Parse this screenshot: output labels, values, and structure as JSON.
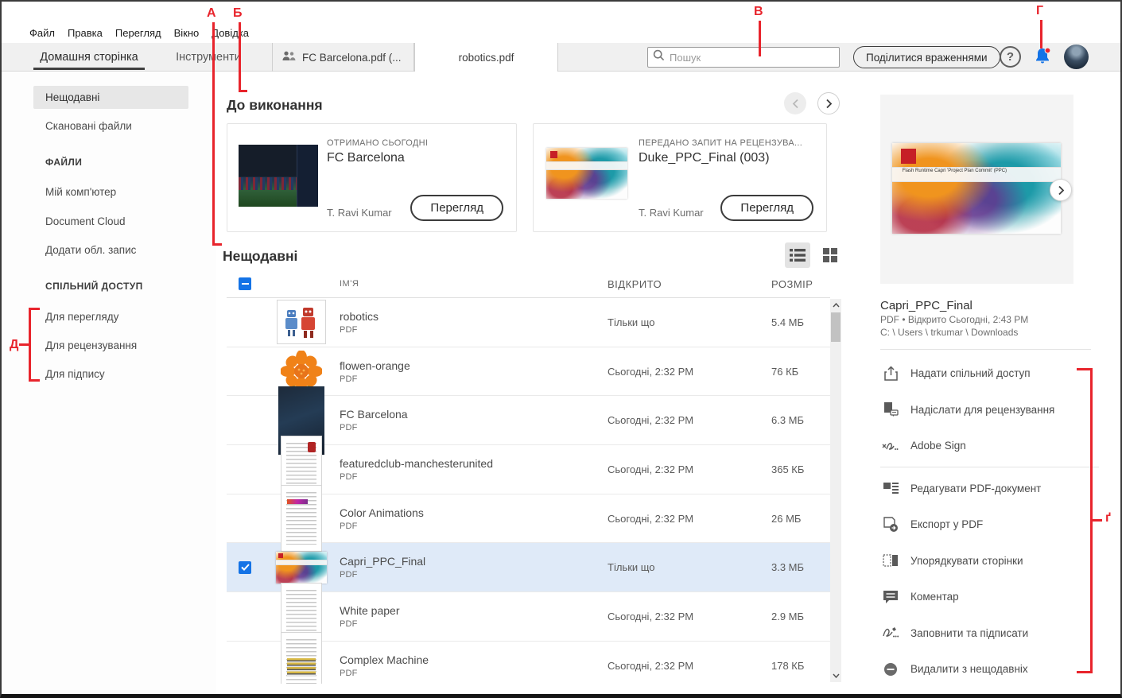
{
  "menubar": {
    "items": [
      "Файл",
      "Правка",
      "Перегляд",
      "Вікно",
      "Довідка"
    ]
  },
  "tabbar": {
    "home": "Домашня сторінка",
    "tools": "Інструменти",
    "doc_tab1": "FC Barcelona.pdf (...",
    "doc_tab2": "robotics.pdf",
    "search_placeholder": "Пошук",
    "share_feedback": "Поділитися враженнями",
    "help_glyph": "?"
  },
  "sidebar": {
    "recent": "Нещодавні",
    "scans": "Скановані файли",
    "files_header": "ФАЙЛИ",
    "my_computer": "Мій комп'ютер",
    "document_cloud": "Document Cloud",
    "add_account": "Додати обл. запис",
    "shared_header": "СПІЛЬНИЙ ДОСТУП",
    "for_viewing": "Для перегляду",
    "for_review": "Для рецензування",
    "for_signature": "Для підпису"
  },
  "todo": {
    "title": "До виконання",
    "cards": [
      {
        "badge": "ОТРИМАНО СЬОГОДНІ",
        "title": "FC Barcelona",
        "owner": "T. Ravi Kumar",
        "action": "Перегляд"
      },
      {
        "badge": "ПЕРЕДАНО ЗАПИТ НА РЕЦЕНЗУВА...",
        "title": "Duke_PPC_Final (003)",
        "owner": "T. Ravi Kumar",
        "action": "Перегляд"
      }
    ]
  },
  "recent": {
    "title": "Нещодавні",
    "columns": {
      "name": "ІМ'Я",
      "opened": "ВІДКРИТО",
      "size": "РОЗМІР"
    },
    "rows": [
      {
        "name": "robotics",
        "type": "PDF",
        "opened": "Тільки що",
        "size": "5.4 МБ"
      },
      {
        "name": "flowen-orange",
        "type": "PDF",
        "opened": "Сьогодні, 2:32 PM",
        "size": "76 КБ"
      },
      {
        "name": "FC Barcelona",
        "type": "PDF",
        "opened": "Сьогодні, 2:32 PM",
        "size": "6.3 МБ"
      },
      {
        "name": "featuredclub-manchesterunited",
        "type": "PDF",
        "opened": "Сьогодні, 2:32 PM",
        "size": "365 КБ"
      },
      {
        "name": "Color Animations",
        "type": "PDF",
        "opened": "Сьогодні, 2:32 PM",
        "size": "26 МБ"
      },
      {
        "name": "Capri_PPC_Final",
        "type": "PDF",
        "opened": "Тільки що",
        "size": "3.3 МБ"
      },
      {
        "name": "White paper",
        "type": "PDF",
        "opened": "Сьогодні, 2:32 PM",
        "size": "2.9 МБ"
      },
      {
        "name": "Complex Machine",
        "type": "PDF",
        "opened": "Сьогодні, 2:32 PM",
        "size": "178 КБ"
      }
    ]
  },
  "details": {
    "preview_title": "Flash Runtime Capri 'Project Plan Commit' (PPC)",
    "title": "Capri_PPC_Final",
    "meta": "PDF  •  Відкрито Сьогодні, 2:43 PM",
    "path": "C: \\ Users \\ trkumar \\ Downloads",
    "actions_top": [
      {
        "label": "Надати спільний доступ"
      },
      {
        "label": "Надіслати для рецензування"
      },
      {
        "label": "Adobe Sign"
      }
    ],
    "actions_bottom": [
      {
        "label": "Редагувати PDF-документ"
      },
      {
        "label": "Експорт у PDF"
      },
      {
        "label": "Упорядкувати сторінки"
      },
      {
        "label": "Коментар"
      },
      {
        "label": "Заповнити та підписати"
      },
      {
        "label": "Видалити з нещодавніх"
      }
    ]
  },
  "annotations": {
    "a": "А",
    "b": "Б",
    "v": "В",
    "g": "Г",
    "d": "Д",
    "gg": "ґ"
  },
  "colors": {
    "accent_blue": "#1473e6",
    "annotation_red": "#e8242c",
    "selected_row": "#dfeaf8"
  }
}
